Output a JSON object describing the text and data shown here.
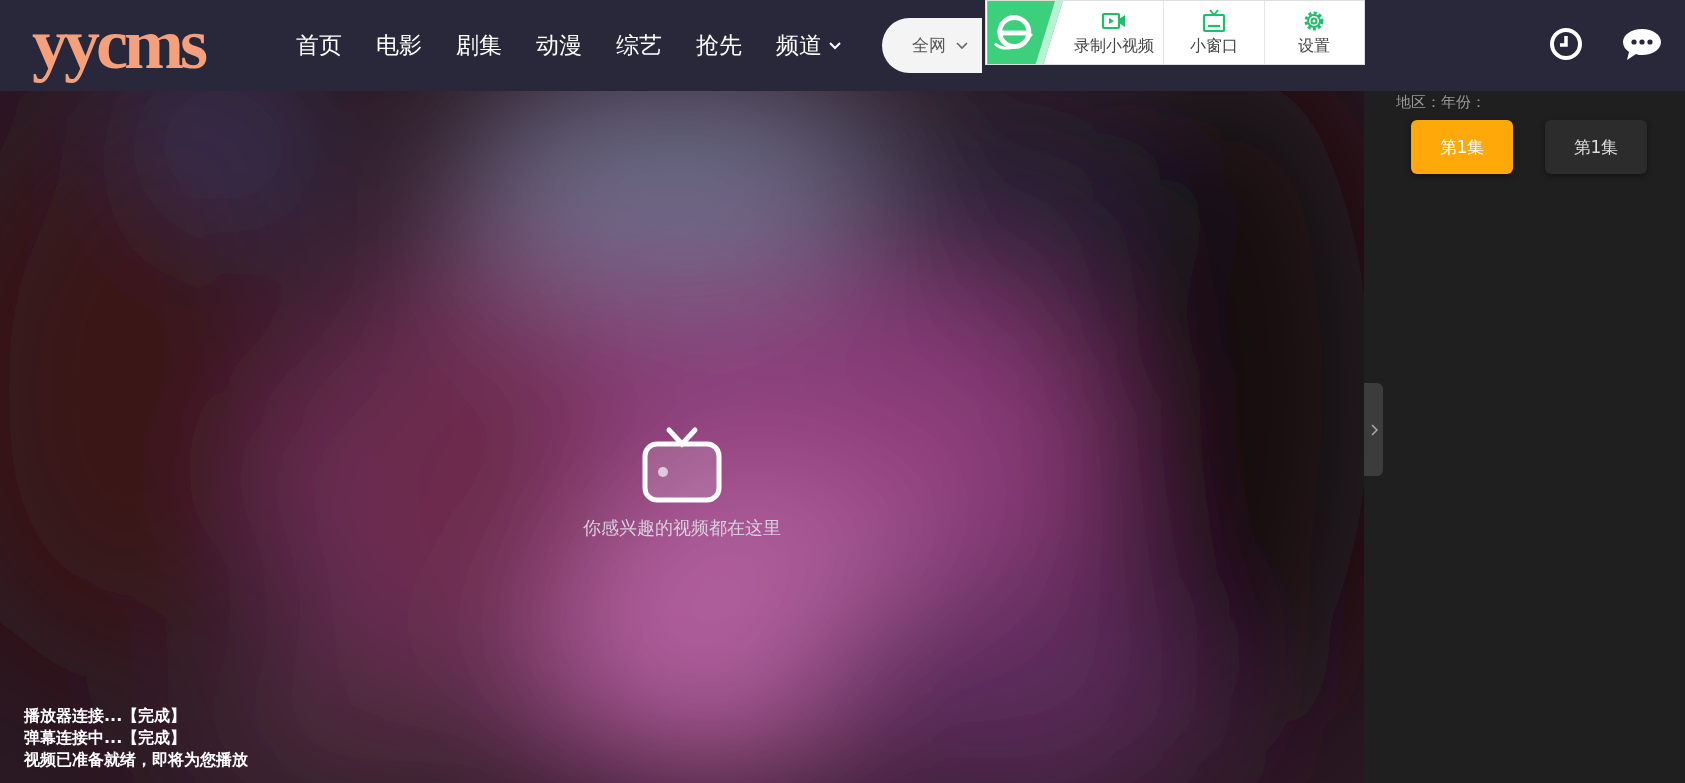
{
  "header": {
    "logo": "yycms",
    "nav": [
      {
        "label": "首页",
        "has_menu": false
      },
      {
        "label": "电影",
        "has_menu": false
      },
      {
        "label": "剧集",
        "has_menu": false
      },
      {
        "label": "动漫",
        "has_menu": false
      },
      {
        "label": "综艺",
        "has_menu": false
      },
      {
        "label": "抢先",
        "has_menu": false
      },
      {
        "label": "频道",
        "has_menu": true
      }
    ],
    "search": {
      "scope": "全网"
    }
  },
  "plugin_toolbar": {
    "items": [
      {
        "kind": "record",
        "label": "录制小视频"
      },
      {
        "kind": "window",
        "label": "小窗口"
      },
      {
        "kind": "settings",
        "label": "设置"
      }
    ]
  },
  "player": {
    "hint": "你感兴趣的视频都在这里",
    "log": [
      "播放器连接...【完成】",
      "弹幕连接中...【完成】",
      "视频已准备就绪，即将为您播放"
    ]
  },
  "sidebar": {
    "meta": "地区：年份：",
    "episodes": [
      {
        "label": "第1集",
        "selected": true
      },
      {
        "label": "第1集",
        "selected": false
      }
    ]
  }
}
